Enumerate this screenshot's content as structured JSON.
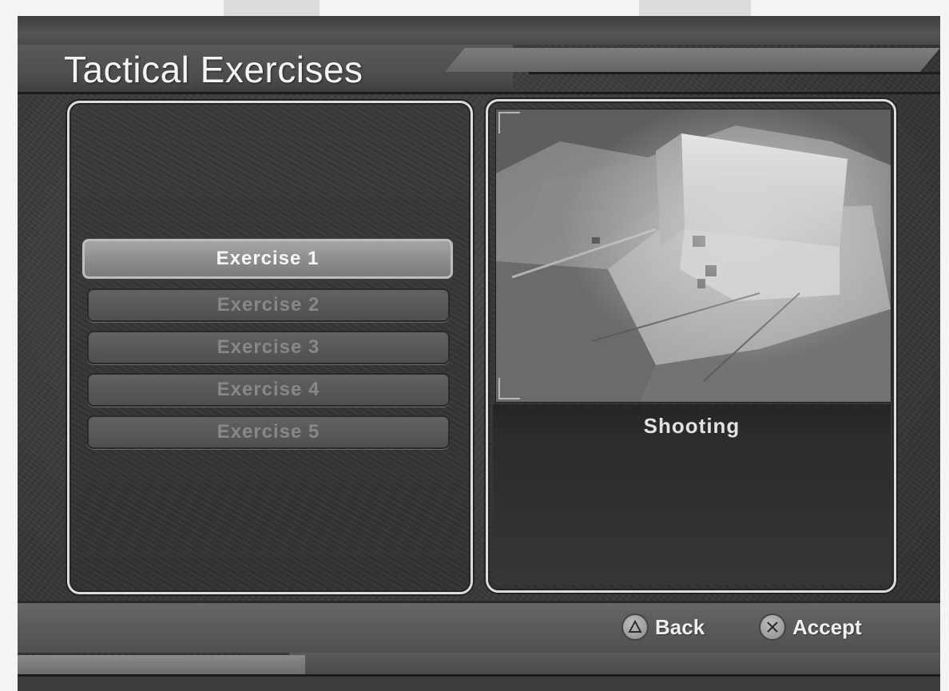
{
  "header": {
    "title": "Tactical Exercises"
  },
  "exercises": {
    "items": [
      {
        "label": "Exercise 1",
        "selected": true
      },
      {
        "label": "Exercise 2",
        "selected": false
      },
      {
        "label": "Exercise 3",
        "selected": false
      },
      {
        "label": "Exercise 4",
        "selected": false
      },
      {
        "label": "Exercise 5",
        "selected": false
      }
    ]
  },
  "preview": {
    "caption": "Shooting"
  },
  "footer": {
    "back": {
      "icon": "triangle-button-icon",
      "label": "Back"
    },
    "accept": {
      "icon": "cross-button-icon",
      "label": "Accept"
    }
  }
}
